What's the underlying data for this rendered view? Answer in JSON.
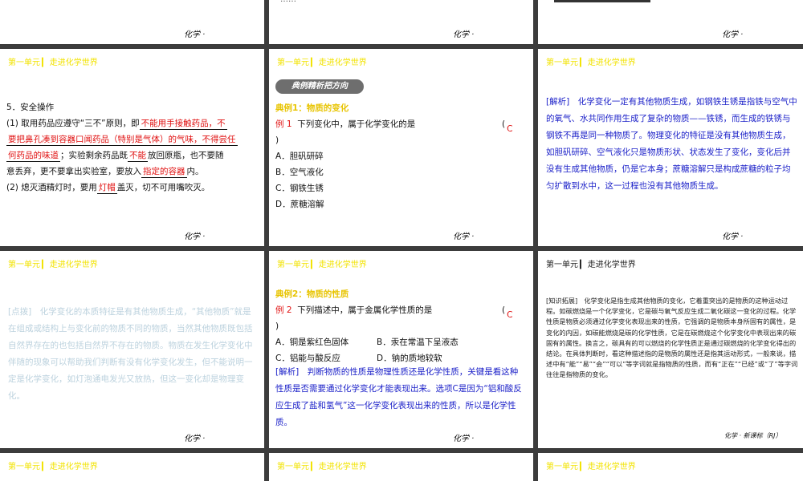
{
  "common": {
    "header_unit": "第一单元",
    "header_bar": "▎",
    "header_title": "走进化学世界",
    "footer": "化学 ·"
  },
  "s1": {
    "title": "5．安全操作",
    "l1a": "(1) 取用药品应遵守“三不”原则，即",
    "f1": "不能用手接触药品，不",
    "l2_fill": "要把鼻孔凑到容器口闻药品（特别是气体）的气味，不得尝任",
    "l3_fill": "何药品的味道",
    "l3b": "；实验剩余药品既",
    "f3": "不能",
    "l3c": "放回原瓶，也不要随",
    "l4a": "意丢弃，更不要拿出实验室，要放入",
    "f4": "指定的容器",
    "l4b": "内。",
    "l5a": "(2) 熄灭酒精灯时，要用",
    "f5": "灯帽",
    "l5b": "盖灭，切不可用嘴吹灭。"
  },
  "s2": {
    "banner": "典例精析把方向",
    "example_title": "典例1：物质的变化",
    "q_label": "例 1",
    "q_text": "下列变化中，属于化学变化的是",
    "paren_open": "(",
    "answer": "C",
    "paren_close": ")",
    "options": [
      "A．胆矾研碎",
      "B．空气液化",
      "C．钢铁生锈",
      "D．蔗糖溶解"
    ]
  },
  "s3": {
    "analysis": "[解析]　化学变化一定有其他物质生成，如钢铁生锈是指铁与空气中的氧气、水共同作用生成了复杂的物质——铁锈，而生成的铁锈与钢铁不再是同一种物质了。物理变化的特征是没有其他物质生成，如胆矾研碎、空气液化只是物质形状、状态发生了变化，变化后并没有生成其他物质，仍是它本身；蔗糖溶解只是构成蔗糖的粒子均匀扩散到水中，这一过程也没有其他物质生成。"
  },
  "s4": {
    "tip": "[点拨]　化学变化的本质特征是有其他物质生成，“其他物质”就是在组成或结构上与变化前的物质不同的物质，当然其他物质既包括自然界存在的也包括自然界不存在的物质。物质在发生化学变化中伴随的现象可以帮助我们判断有没有化学变化发生，但不能说明一定是化学变化，如灯泡通电发光又放热，但这一变化却是物理变化。"
  },
  "s5": {
    "example_title": "典例2：物质的性质",
    "q_label": "例 2",
    "q_text": "下列描述中，属于金属化学性质的是",
    "paren_open": "(",
    "answer": "C",
    "paren_close": ")",
    "optA": "A．铜是紫红色固体",
    "optB": "B．汞在常温下呈液态",
    "optC": "C．铝能与酸反应",
    "optD": "D．钠的质地较软",
    "analysis": "[解析]　判断物质的性质是物理性质还是化学性质，关键是看这种性质是否需要通过化学变化才能表现出来。选项C是因为“铝和酸反应生成了盐和氢气”这一化学变化表现出来的性质，所以是化学性质。"
  },
  "s6": {
    "header_unit": "第一单元",
    "header_bar": "▎",
    "header_title": "走进化学世界",
    "text": "[知识拓展]　化学变化是指生成其他物质的变化，它着重突出的是物质的这种运动过程。如碳燃烧是一个化学变化，它是碳与氧气反应生成二氧化碳这一变化的过程。化学性质是物质必须通过化学变化表现出来的性质，它强调的是物质本身所固有的属性，是变化的内因，如碳能燃烧是碳的化学性质，它是在碳燃烧这个化学变化中表现出来的碳固有的属性。换言之，碳具有的可以燃烧的化学性质正是通过碳燃烧的化学变化得出的结论。在具体判断时，看这种描述指的是物质的属性还是指其运动形式，一般来说，描述中有“能”“易”“会”“可以”等字词就是指物质的性质，而有“正在”“已经”或“了”等字词往往是指物质的变化。",
    "footer": "化学 · 新课标（RJ）"
  },
  "top_partial": {
    "mid_text": "……"
  }
}
